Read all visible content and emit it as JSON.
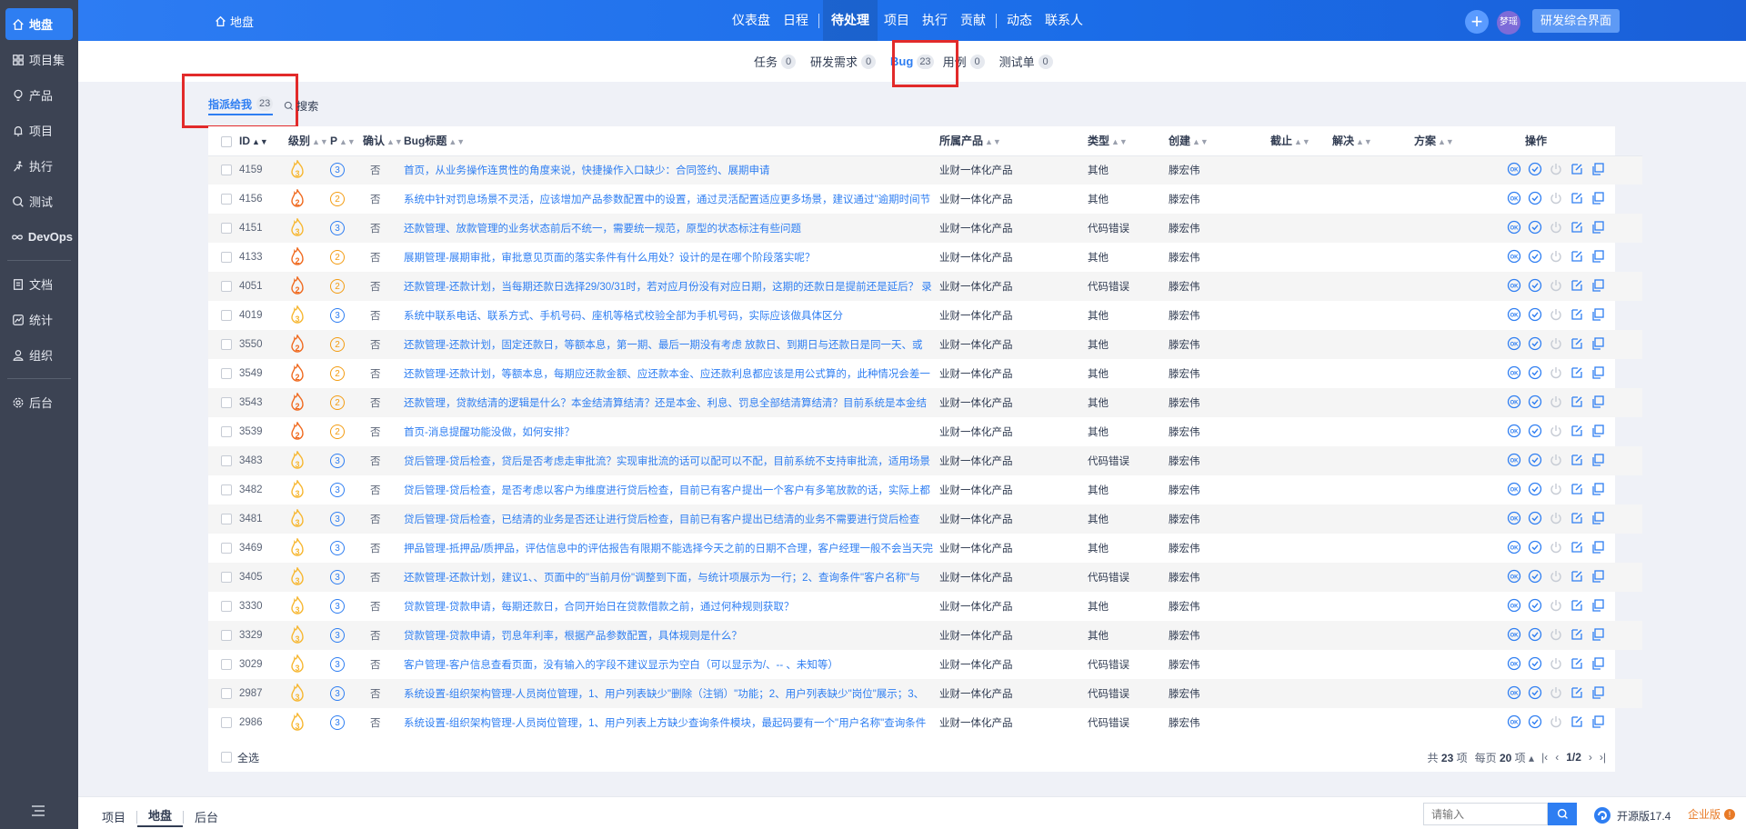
{
  "sidebar": {
    "items": [
      {
        "label": "地盘",
        "icon": "home-icon",
        "active": true
      },
      {
        "label": "项目集",
        "icon": "grid-icon"
      },
      {
        "label": "产品",
        "icon": "bulb-icon"
      },
      {
        "label": "项目",
        "icon": "bell-icon"
      },
      {
        "label": "执行",
        "icon": "run-icon"
      },
      {
        "label": "测试",
        "icon": "search-icon"
      },
      {
        "label": "DevOps",
        "icon": "infinity-icon"
      },
      {
        "label": "文档",
        "icon": "doc-icon"
      },
      {
        "label": "统计",
        "icon": "chart-icon"
      },
      {
        "label": "组织",
        "icon": "user-icon"
      },
      {
        "label": "后台",
        "icon": "gear-icon"
      }
    ]
  },
  "header": {
    "home_label": "地盘",
    "nav": [
      "仪表盘",
      "日程",
      "待处理",
      "项目",
      "执行",
      "贡献",
      "动态",
      "联系人"
    ],
    "avatar_text": "梦瑶",
    "vision_label": "研发综合界面"
  },
  "subtabs": [
    {
      "label": "任务",
      "count": "0"
    },
    {
      "label": "研发需求",
      "count": "0"
    },
    {
      "label": "Bug",
      "count": "23",
      "active": true
    },
    {
      "label": "用例",
      "count": "0"
    },
    {
      "label": "测试单",
      "count": "0"
    }
  ],
  "featurebar": {
    "assigned_label": "指派给我",
    "assigned_count": "23",
    "search_label": "搜索"
  },
  "table": {
    "columns": {
      "id": "ID",
      "severity": "级别",
      "pri": "P",
      "confirm": "确认",
      "title": "Bug标题",
      "product": "所属产品",
      "type": "类型",
      "creator": "创建",
      "deadline": "截止",
      "resolver": "解决",
      "resolution": "方案",
      "actions": "操作"
    },
    "rows": [
      {
        "id": "4159",
        "severity": 3,
        "pri": 3,
        "confirm": "否",
        "title": "首页，从业务操作连贯性的角度来说，快捷操作入口缺少：合同签约、展期申请",
        "product": "业财一体化产品",
        "type": "其他",
        "creator": "滕宏伟"
      },
      {
        "id": "4156",
        "severity": 2,
        "pri": 2,
        "confirm": "否",
        "title": "系统中针对罚息场景不灵活，应该增加产品参数配置中的设置，通过灵活配置适应更多场景，建议通过\"逾期时间节",
        "product": "业财一体化产品",
        "type": "其他",
        "creator": "滕宏伟"
      },
      {
        "id": "4151",
        "severity": 3,
        "pri": 3,
        "confirm": "否",
        "title": "还款管理、放款管理的业务状态前后不统一，需要统一规范，原型的状态标注有些问题",
        "product": "业财一体化产品",
        "type": "代码错误",
        "creator": "滕宏伟"
      },
      {
        "id": "4133",
        "severity": 2,
        "pri": 2,
        "confirm": "否",
        "title": "展期管理-展期审批，审批意见页面的落实条件有什么用处？设计的是在哪个阶段落实呢？",
        "product": "业财一体化产品",
        "type": "其他",
        "creator": "滕宏伟"
      },
      {
        "id": "4051",
        "severity": 2,
        "pri": 2,
        "confirm": "否",
        "title": "还款管理-还款计划，当每期还款日选择29/30/31时，若对应月份没有对应日期，这期的还款日是提前还是延后？ 录",
        "product": "业财一体化产品",
        "type": "代码错误",
        "creator": "滕宏伟"
      },
      {
        "id": "4019",
        "severity": 3,
        "pri": 3,
        "confirm": "否",
        "title": "系统中联系电话、联系方式、手机号码、座机等格式校验全部为手机号码，实际应该做具体区分",
        "product": "业财一体化产品",
        "type": "其他",
        "creator": "滕宏伟"
      },
      {
        "id": "3550",
        "severity": 2,
        "pri": 2,
        "confirm": "否",
        "title": "还款管理-还款计划，固定还款日，等额本息，第一期、最后一期没有考虑 放款日、到期日与还款日是同一天、或",
        "product": "业财一体化产品",
        "type": "其他",
        "creator": "滕宏伟"
      },
      {
        "id": "3549",
        "severity": 2,
        "pri": 2,
        "confirm": "否",
        "title": "还款管理-还款计划，等额本息，每期应还款金额、应还款本金、应还款利息都应该是用公式算的，此种情况会差一",
        "product": "业财一体化产品",
        "type": "其他",
        "creator": "滕宏伟"
      },
      {
        "id": "3543",
        "severity": 2,
        "pri": 2,
        "confirm": "否",
        "title": "还款管理，贷款结清的逻辑是什么？本金结清算结清？还是本金、利息、罚息全部结清算结清？目前系统是本金结",
        "product": "业财一体化产品",
        "type": "其他",
        "creator": "滕宏伟"
      },
      {
        "id": "3539",
        "severity": 2,
        "pri": 2,
        "confirm": "否",
        "title": "首页-消息提醒功能没做，如何安排？",
        "product": "业财一体化产品",
        "type": "其他",
        "creator": "滕宏伟"
      },
      {
        "id": "3483",
        "severity": 3,
        "pri": 3,
        "confirm": "否",
        "title": "贷后管理-贷后检查，贷后是否考虑走审批流？实现审批流的话可以配可以不配，目前系统不支持审批流，适用场景",
        "product": "业财一体化产品",
        "type": "代码错误",
        "creator": "滕宏伟"
      },
      {
        "id": "3482",
        "severity": 3,
        "pri": 3,
        "confirm": "否",
        "title": "贷后管理-贷后检查，是否考虑以客户为维度进行贷后检查，目前已有客户提出一个客户有多笔放款的话，实际上都",
        "product": "业财一体化产品",
        "type": "其他",
        "creator": "滕宏伟"
      },
      {
        "id": "3481",
        "severity": 3,
        "pri": 3,
        "confirm": "否",
        "title": "贷后管理-贷后检查，已结清的业务是否还让进行贷后检查，目前已有客户提出已结清的业务不需要进行贷后检查",
        "product": "业财一体化产品",
        "type": "其他",
        "creator": "滕宏伟"
      },
      {
        "id": "3469",
        "severity": 3,
        "pri": 3,
        "confirm": "否",
        "title": "押品管理-抵押品/质押品，评估信息中的评估报告有限期不能选择今天之前的日期不合理，客户经理一般不会当天完",
        "product": "业财一体化产品",
        "type": "其他",
        "creator": "滕宏伟"
      },
      {
        "id": "3405",
        "severity": 3,
        "pri": 3,
        "confirm": "否",
        "title": "还款管理-还款计划，建议1、、页面中的\"当前月份\"调整到下面，与统计项展示为一行；2、查询条件\"客户名称\"与",
        "product": "业财一体化产品",
        "type": "代码错误",
        "creator": "滕宏伟"
      },
      {
        "id": "3330",
        "severity": 3,
        "pri": 3,
        "confirm": "否",
        "title": "贷款管理-贷款申请，每期还款日，合同开始日在贷款借款之前，通过何种规则获取？",
        "product": "业财一体化产品",
        "type": "其他",
        "creator": "滕宏伟"
      },
      {
        "id": "3329",
        "severity": 3,
        "pri": 3,
        "confirm": "否",
        "title": "贷款管理-贷款申请，罚息年利率，根据产品参数配置，具体规则是什么？",
        "product": "业财一体化产品",
        "type": "其他",
        "creator": "滕宏伟"
      },
      {
        "id": "3029",
        "severity": 3,
        "pri": 3,
        "confirm": "否",
        "title": "客户管理-客户信息查看页面，没有输入的字段不建议显示为空白（可以显示为/、-- 、未知等）",
        "product": "业财一体化产品",
        "type": "代码错误",
        "creator": "滕宏伟"
      },
      {
        "id": "2987",
        "severity": 3,
        "pri": 3,
        "confirm": "否",
        "title": "系统设置-组织架构管理-人员岗位管理，1、用户列表缺少\"删除（注销）\"功能；2、用户列表缺少\"岗位\"展示；3、",
        "product": "业财一体化产品",
        "type": "代码错误",
        "creator": "滕宏伟"
      },
      {
        "id": "2986",
        "severity": 3,
        "pri": 3,
        "confirm": "否",
        "title": "系统设置-组织架构管理-人员岗位管理，1、用户列表上方缺少查询条件模块，最起码要有一个\"用户名称\"查询条件",
        "product": "业财一体化产品",
        "type": "代码错误",
        "creator": "滕宏伟"
      }
    ]
  },
  "table_footer": {
    "select_all": "全选",
    "total_text": "共",
    "total": "23",
    "total_unit": "项",
    "per_page_text": "每页",
    "per_page": "20",
    "per_page_unit": "项",
    "page": "1/2"
  },
  "footer": {
    "crumbs": [
      "项目",
      "地盘",
      "后台"
    ],
    "search_placeholder": "请输入",
    "version": "开源版17.4",
    "enterprise": "企业版"
  },
  "colors": {
    "primary": "#2e7ef2",
    "sidebar_bg": "#3c4353",
    "highlight_box": "#e22a2a",
    "severity_2": "#f06a1f",
    "severity_3": "#f7b731"
  }
}
